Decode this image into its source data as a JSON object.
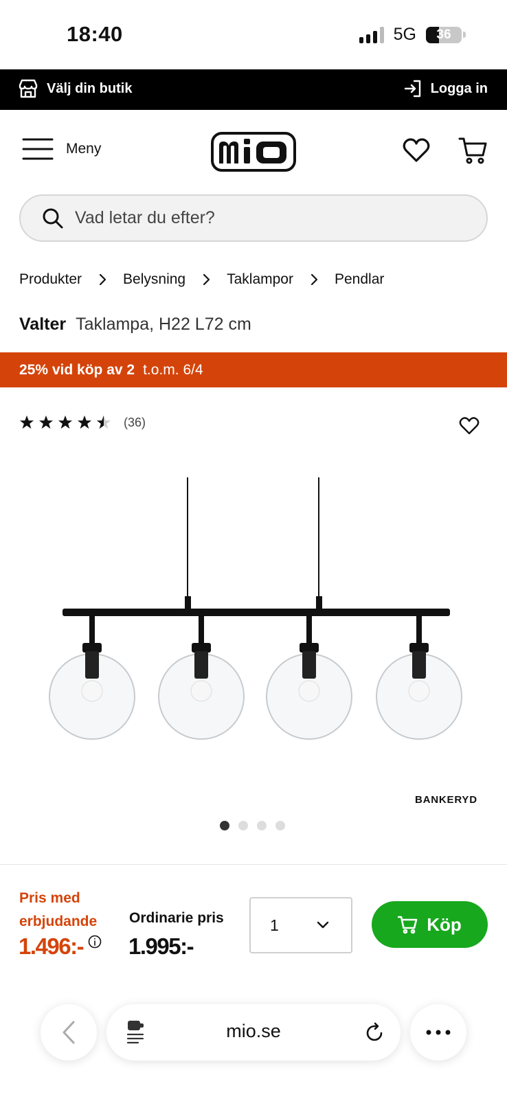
{
  "status_bar": {
    "time": "18:40",
    "network": "5G",
    "battery": "36"
  },
  "topbar": {
    "store_label": "Välj din butik",
    "login_label": "Logga in"
  },
  "header": {
    "menu_label": "Meny",
    "logo_text": "mio"
  },
  "search": {
    "placeholder": "Vad letar du efter?"
  },
  "breadcrumb": [
    "Produkter",
    "Belysning",
    "Taklampor",
    "Pendlar"
  ],
  "product": {
    "brand": "Valter",
    "description": "Taklampa, H22 L72 cm",
    "rating": 4.5,
    "rating_count": "(36)",
    "image_watermark": "BANKERYD",
    "image_count": 4,
    "active_image": 1
  },
  "promo": {
    "headline": "25% vid köp av 2",
    "validity": "t.o.m. 6/4"
  },
  "pricing": {
    "offer_label": "Pris med erbjudande",
    "offer_price": "1.496:-",
    "regular_label": "Ordinarie pris",
    "regular_price": "1.995:-",
    "quantity": "1",
    "buy_label": "Köp"
  },
  "browser": {
    "url": "mio.se"
  },
  "colors": {
    "accent": "#d4440a",
    "buy": "#17a81d",
    "topbar": "#000000"
  }
}
